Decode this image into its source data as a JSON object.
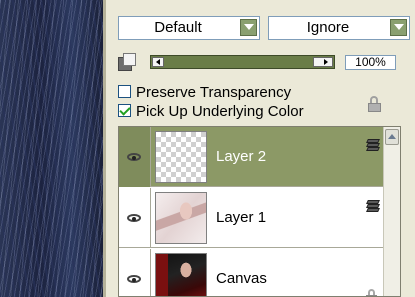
{
  "blend_mode": {
    "value": "Default"
  },
  "alpha_mode": {
    "value": "Ignore"
  },
  "opacity": {
    "value": "100%",
    "level": 1.0
  },
  "options": {
    "preserve_transparency": {
      "label": "Preserve Transparency",
      "checked": false
    },
    "pick_up_underlying_color": {
      "label": "Pick Up Underlying Color",
      "checked": true
    }
  },
  "layers": [
    {
      "name": "Layer 2",
      "visible": true,
      "selected": true,
      "thumbnail": "transparent",
      "icon": "layer-stack-icon"
    },
    {
      "name": "Layer 1",
      "visible": true,
      "selected": false,
      "thumbnail": "photo",
      "icon": "layer-stack-icon"
    },
    {
      "name": "Canvas",
      "visible": true,
      "selected": false,
      "thumbnail": "photo",
      "icon": "lock-icon"
    }
  ],
  "colors": {
    "panel_bg": "#ebe9d8",
    "selected_layer": "#8c9966",
    "slider_track": "#6a7d47",
    "dropdown_button": "#8aa070"
  }
}
